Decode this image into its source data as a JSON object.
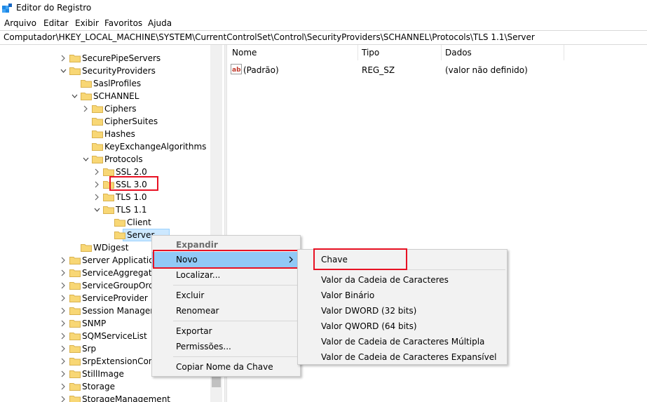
{
  "window": {
    "title": "Editor do Registro",
    "icon": "registry-editor-icon"
  },
  "menubar": {
    "items": [
      "Arquivo",
      "Editar",
      "Exibir",
      "Favoritos",
      "Ajuda"
    ]
  },
  "address": {
    "path": "Computador\\HKEY_LOCAL_MACHINE\\SYSTEM\\CurrentControlSet\\Control\\SecurityProviders\\SCHANNEL\\Protocols\\TLS 1.1\\Server"
  },
  "tree": {
    "items": [
      {
        "label": "SecurePipeServers",
        "state": "collapsed"
      },
      {
        "label": "SecurityProviders",
        "state": "expanded"
      },
      {
        "label": "SaslProfiles",
        "state": "leaf"
      },
      {
        "label": "SCHANNEL",
        "state": "expanded"
      },
      {
        "label": "Ciphers",
        "state": "collapsed"
      },
      {
        "label": "CipherSuites",
        "state": "leaf"
      },
      {
        "label": "Hashes",
        "state": "leaf"
      },
      {
        "label": "KeyExchangeAlgorithms",
        "state": "leaf"
      },
      {
        "label": "Protocols",
        "state": "expanded"
      },
      {
        "label": "SSL 2.0",
        "state": "collapsed"
      },
      {
        "label": "SSL 3.0",
        "state": "collapsed"
      },
      {
        "label": "TLS 1.0",
        "state": "collapsed"
      },
      {
        "label": "TLS 1.1",
        "state": "expanded"
      },
      {
        "label": "Client",
        "state": "leaf"
      },
      {
        "label": "Server",
        "state": "leaf",
        "selected": true
      },
      {
        "label": "WDigest",
        "state": "leaf"
      },
      {
        "label": "Server Application",
        "state": "collapsed"
      },
      {
        "label": "ServiceAggregate",
        "state": "collapsed"
      },
      {
        "label": "ServiceGroupOrde",
        "state": "collapsed"
      },
      {
        "label": "ServiceProvider",
        "state": "collapsed"
      },
      {
        "label": "Session Manager",
        "state": "collapsed"
      },
      {
        "label": "SNMP",
        "state": "collapsed"
      },
      {
        "label": "SQMServiceList",
        "state": "collapsed"
      },
      {
        "label": "Srp",
        "state": "collapsed"
      },
      {
        "label": "SrpExtensionConf",
        "state": "collapsed"
      },
      {
        "label": "StillImage",
        "state": "collapsed"
      },
      {
        "label": "Storage",
        "state": "collapsed"
      },
      {
        "label": "StorageManagement",
        "state": "collapsed"
      }
    ]
  },
  "list": {
    "columns": [
      "Nome",
      "Tipo",
      "Dados"
    ],
    "rows": [
      {
        "name": "(Padrão)",
        "type": "REG_SZ",
        "data": "(valor não definido)",
        "icon": "string-value-icon"
      }
    ]
  },
  "context_menu": {
    "items": [
      "Expandir",
      "Novo",
      "Localizar...",
      "Excluir",
      "Renomear",
      "Exportar",
      "Permissões...",
      "Copiar Nome da Chave"
    ]
  },
  "submenu": {
    "items": [
      "Chave",
      "Valor da Cadeia de Caracteres",
      "Valor Binário",
      "Valor DWORD (32 bits)",
      "Valor QWORD (64 bits)",
      "Valor de Cadeia de Caracteres Múltipla",
      "Valor de Cadeia de Caracteres Expansível"
    ]
  },
  "colors": {
    "folder": "#f8d775",
    "selection": "#cce8ff",
    "menu_highlight": "#91c9f7",
    "annotation_red": "#e81123"
  }
}
